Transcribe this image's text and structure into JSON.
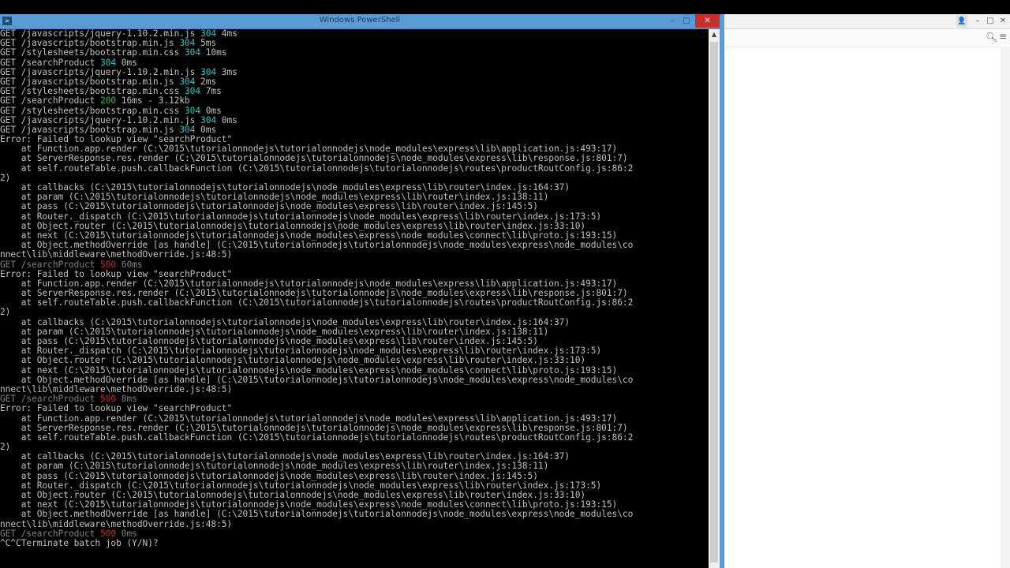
{
  "powershell": {
    "title": "Windows PowerShell",
    "icon": "powershell-icon",
    "controls": {
      "minimize": "–",
      "maximize": "□",
      "close": "✕"
    },
    "lines": [
      {
        "parts": [
          {
            "t": "GET /javascripts/jquery-1.10.2.min.js "
          },
          {
            "t": "304",
            "s": "c304"
          },
          {
            "t": " 4ms"
          }
        ]
      },
      {
        "parts": [
          {
            "t": "GET /javascripts/bootstrap.min.js "
          },
          {
            "t": "304",
            "s": "c304"
          },
          {
            "t": " 5ms"
          }
        ]
      },
      {
        "parts": [
          {
            "t": "GET /stylesheets/bootstrap.min.css "
          },
          {
            "t": "304",
            "s": "c304"
          },
          {
            "t": " 10ms"
          }
        ]
      },
      {
        "parts": [
          {
            "t": "GET /searchProduct "
          },
          {
            "t": "304",
            "s": "c304"
          },
          {
            "t": " 0ms"
          }
        ]
      },
      {
        "parts": [
          {
            "t": "GET /javascripts/jquery-1.10.2.min.js "
          },
          {
            "t": "304",
            "s": "c304"
          },
          {
            "t": " 3ms"
          }
        ]
      },
      {
        "parts": [
          {
            "t": "GET /javascripts/bootstrap.min.js "
          },
          {
            "t": "304",
            "s": "c304"
          },
          {
            "t": " 2ms"
          }
        ]
      },
      {
        "parts": [
          {
            "t": "GET /stylesheets/bootstrap.min.css "
          },
          {
            "t": "304",
            "s": "c304"
          },
          {
            "t": " 7ms"
          }
        ]
      },
      {
        "parts": [
          {
            "t": "GET /searchProduct "
          },
          {
            "t": "200",
            "s": "c200"
          },
          {
            "t": " 16ms - 3.12kb"
          }
        ]
      },
      {
        "parts": [
          {
            "t": "GET /stylesheets/bootstrap.min.css "
          },
          {
            "t": "304",
            "s": "c304"
          },
          {
            "t": " 0ms"
          }
        ]
      },
      {
        "parts": [
          {
            "t": "GET /javascripts/jquery-1.10.2.min.js "
          },
          {
            "t": "304",
            "s": "c304"
          },
          {
            "t": " 0ms"
          }
        ]
      },
      {
        "parts": [
          {
            "t": "GET /javascripts/bootstrap.min.js "
          },
          {
            "t": "304",
            "s": "c304"
          },
          {
            "t": " 0ms"
          }
        ]
      },
      {
        "parts": [
          {
            "t": "Error: Failed to lookup view \"searchProduct\""
          }
        ]
      },
      {
        "parts": [
          {
            "t": "    at Function.app.render (C:\\2015\\tutorialonnodejs\\tutorialonnodejs\\node_modules\\express\\lib\\application.js:493:17)"
          }
        ]
      },
      {
        "parts": [
          {
            "t": "    at ServerResponse.res.render (C:\\2015\\tutorialonnodejs\\tutorialonnodejs\\node_modules\\express\\lib\\response.js:801:7)"
          }
        ]
      },
      {
        "parts": [
          {
            "t": "    at self.routeTable.push.callbackFunction (C:\\2015\\tutorialonnodejs\\tutorialonnodejs\\routes\\productRoutConfig.js:86:2"
          }
        ]
      },
      {
        "parts": [
          {
            "t": "2)"
          }
        ]
      },
      {
        "parts": [
          {
            "t": "    at callbacks (C:\\2015\\tutorialonnodejs\\tutorialonnodejs\\node_modules\\express\\lib\\router\\index.js:164:37)"
          }
        ]
      },
      {
        "parts": [
          {
            "t": "    at param (C:\\2015\\tutorialonnodejs\\tutorialonnodejs\\node_modules\\express\\lib\\router\\index.js:138:11)"
          }
        ]
      },
      {
        "parts": [
          {
            "t": "    at pass (C:\\2015\\tutorialonnodejs\\tutorialonnodejs\\node_modules\\express\\lib\\router\\index.js:145:5)"
          }
        ]
      },
      {
        "parts": [
          {
            "t": "    at Router._dispatch (C:\\2015\\tutorialonnodejs\\tutorialonnodejs\\node_modules\\express\\lib\\router\\index.js:173:5)"
          }
        ]
      },
      {
        "parts": [
          {
            "t": "    at Object.router (C:\\2015\\tutorialonnodejs\\tutorialonnodejs\\node_modules\\express\\lib\\router\\index.js:33:10)"
          }
        ]
      },
      {
        "parts": [
          {
            "t": "    at next (C:\\2015\\tutorialonnodejs\\tutorialonnodejs\\node_modules\\express\\node_modules\\connect\\lib\\proto.js:193:15)"
          }
        ]
      },
      {
        "parts": [
          {
            "t": "    at Object.methodOverride [as handle] (C:\\2015\\tutorialonnodejs\\tutorialonnodejs\\node_modules\\express\\node_modules\\co"
          }
        ]
      },
      {
        "parts": [
          {
            "t": "nnect\\lib\\middleware\\methodOverride.js:48:5)"
          }
        ]
      },
      {
        "dim": true,
        "parts": [
          {
            "t": "GET /searchProduct "
          },
          {
            "t": "500",
            "s": "c500"
          },
          {
            "t": " 60ms"
          }
        ]
      },
      {
        "parts": [
          {
            "t": "Error: Failed to lookup view \"searchProduct\""
          }
        ]
      },
      {
        "parts": [
          {
            "t": "    at Function.app.render (C:\\2015\\tutorialonnodejs\\tutorialonnodejs\\node_modules\\express\\lib\\application.js:493:17)"
          }
        ]
      },
      {
        "parts": [
          {
            "t": "    at ServerResponse.res.render (C:\\2015\\tutorialonnodejs\\tutorialonnodejs\\node_modules\\express\\lib\\response.js:801:7)"
          }
        ]
      },
      {
        "parts": [
          {
            "t": "    at self.routeTable.push.callbackFunction (C:\\2015\\tutorialonnodejs\\tutorialonnodejs\\routes\\productRoutConfig.js:86:2"
          }
        ]
      },
      {
        "parts": [
          {
            "t": "2)"
          }
        ]
      },
      {
        "parts": [
          {
            "t": "    at callbacks (C:\\2015\\tutorialonnodejs\\tutorialonnodejs\\node_modules\\express\\lib\\router\\index.js:164:37)"
          }
        ]
      },
      {
        "parts": [
          {
            "t": "    at param (C:\\2015\\tutorialonnodejs\\tutorialonnodejs\\node_modules\\express\\lib\\router\\index.js:138:11)"
          }
        ]
      },
      {
        "parts": [
          {
            "t": "    at pass (C:\\2015\\tutorialonnodejs\\tutorialonnodejs\\node_modules\\express\\lib\\router\\index.js:145:5)"
          }
        ]
      },
      {
        "parts": [
          {
            "t": "    at Router._dispatch (C:\\2015\\tutorialonnodejs\\tutorialonnodejs\\node_modules\\express\\lib\\router\\index.js:173:5)"
          }
        ]
      },
      {
        "parts": [
          {
            "t": "    at Object.router (C:\\2015\\tutorialonnodejs\\tutorialonnodejs\\node_modules\\express\\lib\\router\\index.js:33:10)"
          }
        ]
      },
      {
        "parts": [
          {
            "t": "    at next (C:\\2015\\tutorialonnodejs\\tutorialonnodejs\\node_modules\\express\\node_modules\\connect\\lib\\proto.js:193:15)"
          }
        ]
      },
      {
        "parts": [
          {
            "t": "    at Object.methodOverride [as handle] (C:\\2015\\tutorialonnodejs\\tutorialonnodejs\\node_modules\\express\\node_modules\\co"
          }
        ]
      },
      {
        "parts": [
          {
            "t": "nnect\\lib\\middleware\\methodOverride.js:48:5)"
          }
        ]
      },
      {
        "dim": true,
        "parts": [
          {
            "t": "GET /searchProduct "
          },
          {
            "t": "500",
            "s": "c500"
          },
          {
            "t": " 8ms"
          }
        ]
      },
      {
        "parts": [
          {
            "t": "Error: Failed to lookup view \"searchProduct\""
          }
        ]
      },
      {
        "parts": [
          {
            "t": "    at Function.app.render (C:\\2015\\tutorialonnodejs\\tutorialonnodejs\\node_modules\\express\\lib\\application.js:493:17)"
          }
        ]
      },
      {
        "parts": [
          {
            "t": "    at ServerResponse.res.render (C:\\2015\\tutorialonnodejs\\tutorialonnodejs\\node_modules\\express\\lib\\response.js:801:7)"
          }
        ]
      },
      {
        "parts": [
          {
            "t": "    at self.routeTable.push.callbackFunction (C:\\2015\\tutorialonnodejs\\tutorialonnodejs\\routes\\productRoutConfig.js:86:2"
          }
        ]
      },
      {
        "parts": [
          {
            "t": "2)"
          }
        ]
      },
      {
        "parts": [
          {
            "t": "    at callbacks (C:\\2015\\tutorialonnodejs\\tutorialonnodejs\\node_modules\\express\\lib\\router\\index.js:164:37)"
          }
        ]
      },
      {
        "parts": [
          {
            "t": "    at param (C:\\2015\\tutorialonnodejs\\tutorialonnodejs\\node_modules\\express\\lib\\router\\index.js:138:11)"
          }
        ]
      },
      {
        "parts": [
          {
            "t": "    at pass (C:\\2015\\tutorialonnodejs\\tutorialonnodejs\\node_modules\\express\\lib\\router\\index.js:145:5)"
          }
        ]
      },
      {
        "parts": [
          {
            "t": "    at Router._dispatch (C:\\2015\\tutorialonnodejs\\tutorialonnodejs\\node_modules\\express\\lib\\router\\index.js:173:5)"
          }
        ]
      },
      {
        "parts": [
          {
            "t": "    at Object.router (C:\\2015\\tutorialonnodejs\\tutorialonnodejs\\node_modules\\express\\lib\\router\\index.js:33:10)"
          }
        ]
      },
      {
        "parts": [
          {
            "t": "    at next (C:\\2015\\tutorialonnodejs\\tutorialonnodejs\\node_modules\\express\\node_modules\\connect\\lib\\proto.js:193:15)"
          }
        ]
      },
      {
        "parts": [
          {
            "t": "    at Object.methodOverride [as handle] (C:\\2015\\tutorialonnodejs\\tutorialonnodejs\\node_modules\\express\\node_modules\\co"
          }
        ]
      },
      {
        "parts": [
          {
            "t": "nnect\\lib\\middleware\\methodOverride.js:48:5)"
          }
        ]
      },
      {
        "dim": true,
        "parts": [
          {
            "t": "GET /searchProduct "
          },
          {
            "t": "500",
            "s": "c500"
          },
          {
            "t": " 0ms"
          }
        ]
      },
      {
        "parts": [
          {
            "t": "^C^CTerminate batch job (Y/N)?"
          }
        ]
      }
    ]
  },
  "browser": {
    "controls": {
      "user": "👤",
      "minimize": "–",
      "maximize": "□",
      "close": "✕"
    },
    "zoom_icon": "zoom-icon",
    "menu_icon": "menu-icon"
  },
  "colors": {
    "status_304": "#27c9c9",
    "status_200": "#2ec42e",
    "status_500": "#d02424",
    "titlebar": "#5b9bd5"
  }
}
